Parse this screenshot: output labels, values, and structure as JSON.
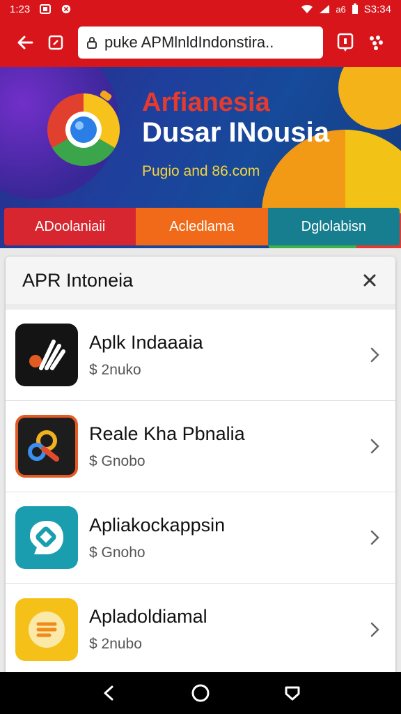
{
  "status_bar": {
    "time": "1:23",
    "battery_label": "a6",
    "clock": "S3:34",
    "icons": [
      "square-icon",
      "close-circle-icon",
      "wifi-icon",
      "signal-icon",
      "battery-icon"
    ]
  },
  "toolbar": {
    "url": "puke APMlnldIndonstira..",
    "icons": [
      "back-arrow-icon",
      "tab-icon",
      "lock-icon",
      "bookmark-icon",
      "menu-dots-icon"
    ]
  },
  "banner": {
    "title_line1": "Arfianesia",
    "title_line2": "Dusar INousia",
    "subtitle": "Pugio and 86.com",
    "categories": [
      "ADoolaniaii",
      "Acledlama",
      "Dglolabisn"
    ],
    "colors": {
      "title_red": "#e53b2f",
      "subtitle_yellow": "#f5d43a"
    }
  },
  "panel": {
    "title": "APR Intoneia",
    "apps": [
      {
        "name": "Aplk Indaaaia",
        "price": "$ 2nuko",
        "icon": "dark-app-icon"
      },
      {
        "name": "Reale Kha Pbnalia",
        "price": "$ Gnobo",
        "icon": "link-app-icon"
      },
      {
        "name": "Apliakockappsin",
        "price": "$ Gnoho",
        "icon": "chat-app-icon"
      },
      {
        "name": "Apladoldiamal",
        "price": "$ 2nubo",
        "icon": "notes-app-icon"
      }
    ]
  },
  "accent_color": "#d7151b"
}
